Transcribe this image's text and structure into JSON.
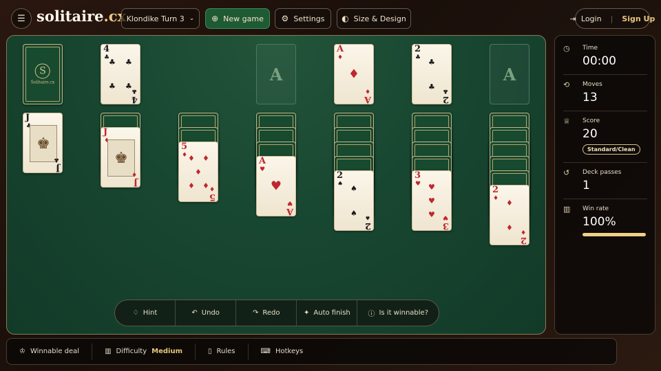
{
  "header": {
    "menu_icon": "hamburger-icon",
    "logo_main": "solitaire",
    "logo_suffix": ".cx",
    "game_select": "Klondike Turn 3",
    "new_game": "New game",
    "settings": "Settings",
    "size_design": "Size & Design",
    "login": "Login",
    "signup": "Sign Up"
  },
  "board": {
    "stock_brand": "Solitaire.cx",
    "stock_monogram": "S",
    "foundation_placeholder": "A",
    "colors": {
      "table": "#184731",
      "card": "#fbf6ea",
      "red": "#c0272d",
      "black": "#1b1b1b"
    },
    "waste": {
      "rank": "4",
      "suit": "♣"
    },
    "foundations": [
      {
        "empty": true
      },
      {
        "rank": "A",
        "suit": "♦"
      },
      {
        "rank": "2",
        "suit": "♣"
      },
      {
        "empty": true
      }
    ],
    "tableau": [
      {
        "rank": "J",
        "suit": "♣"
      },
      {
        "rank": "J",
        "suit": "♦"
      },
      {
        "rank": "5",
        "suit": "♦"
      },
      {
        "rank": "A",
        "suit": "♥"
      },
      {
        "rank": "2",
        "suit": "♠"
      },
      {
        "rank": "3",
        "suit": "♥"
      },
      {
        "rank": "2",
        "suit": "♦"
      }
    ]
  },
  "actions": {
    "hint": "Hint",
    "undo": "Undo",
    "redo": "Redo",
    "auto_finish": "Auto finish",
    "winnable": "Is it winnable?"
  },
  "stats": {
    "time_label": "Time",
    "time_value": "00:00",
    "moves_label": "Moves",
    "moves_value": "13",
    "score_label": "Score",
    "score_value": "20",
    "score_badge": "Standard/Clean",
    "passes_label": "Deck passes",
    "passes_value": "1",
    "winrate_label": "Win rate",
    "winrate_value": "100%",
    "winrate_fraction": 1.0
  },
  "footer": {
    "winnable_deal": "Winnable deal",
    "difficulty_label": "Difficulty",
    "difficulty_value": "Medium",
    "rules": "Rules",
    "hotkeys": "Hotkeys"
  }
}
